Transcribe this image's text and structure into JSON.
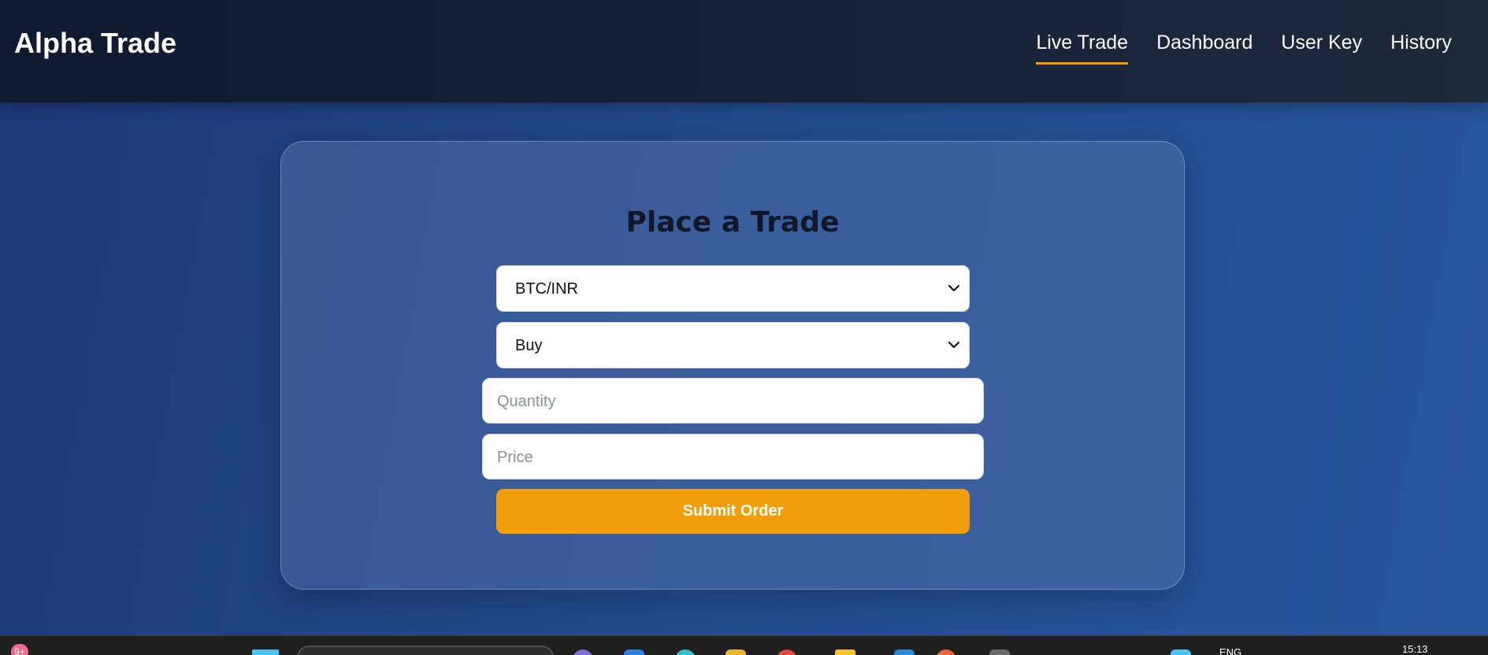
{
  "app": {
    "brand": "Alpha Trade"
  },
  "nav": {
    "items": [
      {
        "label": "Live Trade",
        "active": true
      },
      {
        "label": "Dashboard",
        "active": false
      },
      {
        "label": "User Key",
        "active": false
      },
      {
        "label": "History",
        "active": false
      }
    ],
    "accent_color": "#f59e0b"
  },
  "trade_form": {
    "title": "Place a Trade",
    "pair_select": {
      "value": "BTC/INR"
    },
    "side_select": {
      "value": "Buy"
    },
    "quantity_input": {
      "value": "",
      "placeholder": "Quantity"
    },
    "price_input": {
      "value": "",
      "placeholder": "Price"
    },
    "submit_label": "Submit Order",
    "submit_color": "#f29e0c"
  },
  "taskbar": {
    "notification_badge": "9+",
    "language": "ENG",
    "time": "15:13"
  }
}
